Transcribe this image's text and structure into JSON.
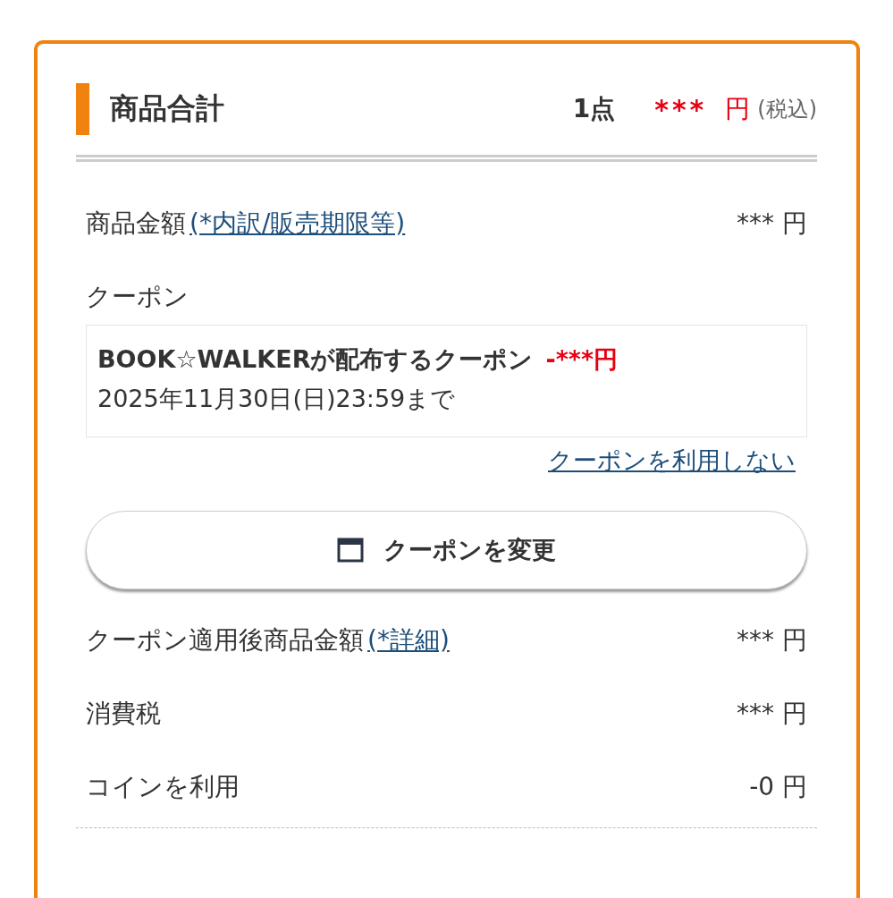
{
  "summary": {
    "title": "商品合計",
    "count": "1点",
    "price": "***",
    "currency": "円",
    "tax_note": "(税込)"
  },
  "item_amount": {
    "label": "商品金額",
    "link": "(*内訳/販売期限等)",
    "value": "*** 円"
  },
  "coupon": {
    "label": "クーポン",
    "name": "BOOK☆WALKERが配布するクーポン",
    "discount": "-***円",
    "expiry": "2025年11月30日(日)23:59まで",
    "remove_link": "クーポンを利用しない",
    "change_button": "クーポンを変更"
  },
  "rows": [
    {
      "label": "クーポン適用後商品金額",
      "link": "(*詳細)",
      "value": "*** 円"
    },
    {
      "label": "消費税",
      "value": "*** 円"
    },
    {
      "label": "コインを利用",
      "value": "-0 円"
    }
  ]
}
